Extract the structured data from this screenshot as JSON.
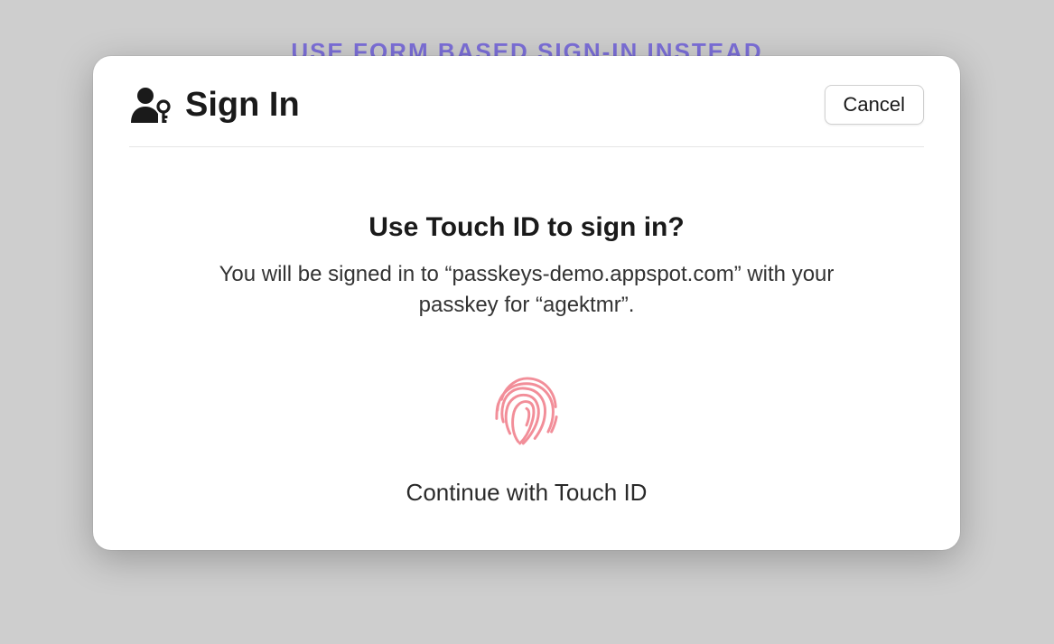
{
  "background": {
    "link_text": "USE FORM BASED SIGN-IN INSTEAD"
  },
  "sheet": {
    "title": "Sign In",
    "cancel_label": "Cancel",
    "prompt_title": "Use Touch ID to sign in?",
    "prompt_desc": "You will be signed in to “passkeys-demo.appspot.com” with your passkey for “agektmr”.",
    "continue_label": "Continue with Touch ID"
  },
  "colors": {
    "accent_link": "#7c6fd8",
    "fingerprint": "#f28e99"
  }
}
